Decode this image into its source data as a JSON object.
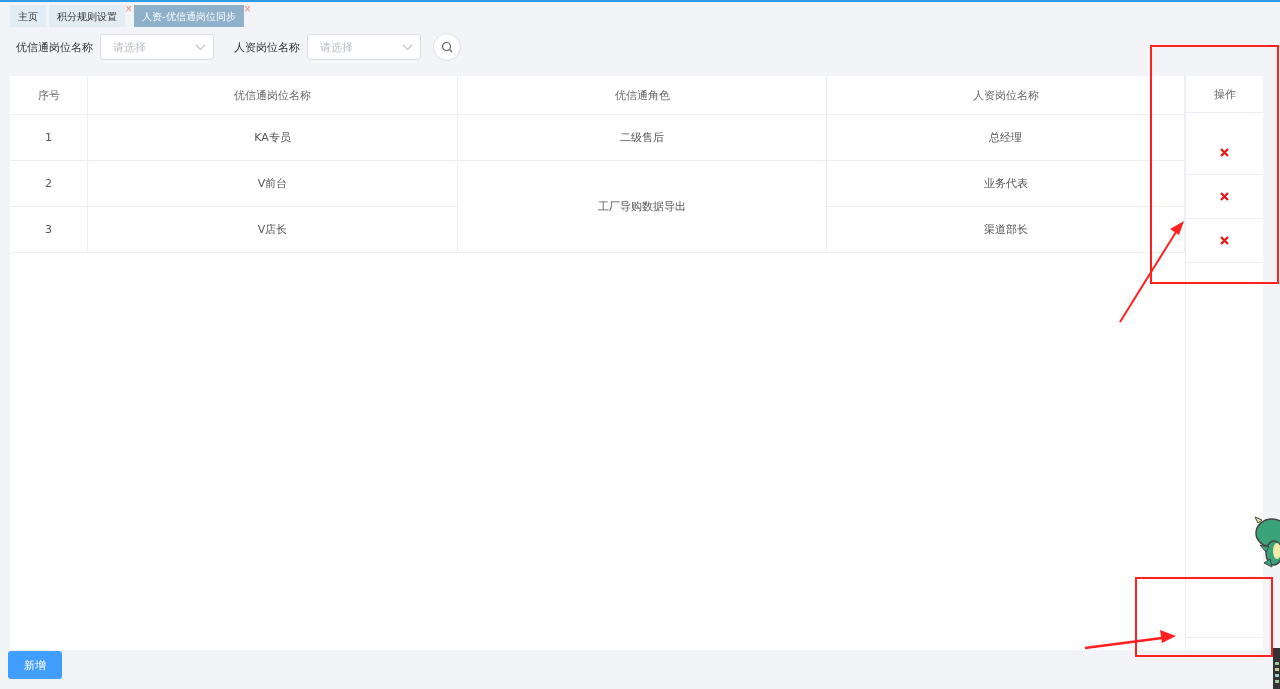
{
  "tabs": [
    {
      "label": "主页",
      "selected": false
    },
    {
      "label": "积分规则设置",
      "selected": false,
      "close": "×"
    },
    {
      "label": "人资-优信通岗位同步",
      "selected": true,
      "close": "×"
    }
  ],
  "filters": [
    {
      "label": "优信通岗位名称",
      "placeholder": "请选择"
    },
    {
      "label": "人资岗位名称",
      "placeholder": "请选择"
    }
  ],
  "table": {
    "columns": [
      "序号",
      "优信通岗位名称",
      "优信通角色",
      "人资岗位名称",
      "操作"
    ],
    "groups": [
      {
        "role": "二级售后",
        "rows": [
          {
            "index": "1",
            "name": "KA专员",
            "hr": "总经理"
          }
        ]
      },
      {
        "role": "工厂导购数据导出",
        "rows": [
          {
            "index": "2",
            "name": "V前台",
            "hr": "业务代表"
          },
          {
            "index": "3",
            "name": "V店长",
            "hr": "渠道部长"
          }
        ]
      }
    ]
  },
  "add_button": "新增"
}
